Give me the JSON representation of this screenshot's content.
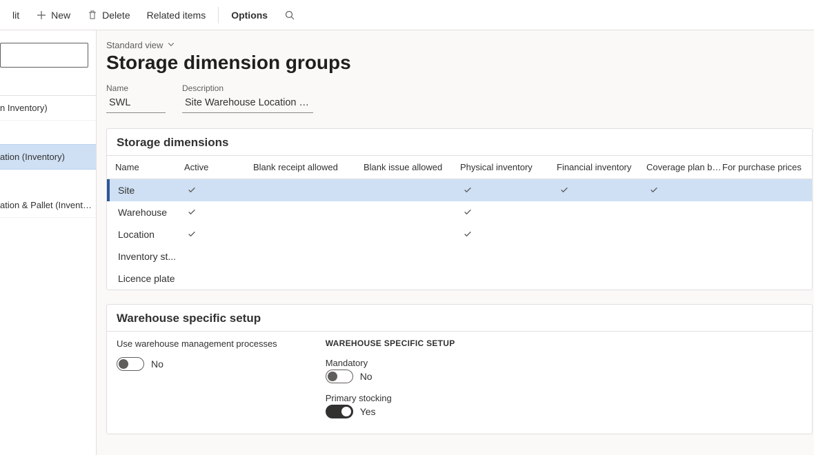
{
  "commandbar": {
    "edit": "lit",
    "new": "New",
    "delete": "Delete",
    "related": "Related items",
    "options": "Options"
  },
  "sidebar": {
    "items": [
      "n Inventory)",
      "ation (Inventory)",
      "ation & Pallet (Inventory)"
    ],
    "selected_index": 1
  },
  "view_switch": "Standard view",
  "page_title": "Storage dimension groups",
  "fields": {
    "name_label": "Name",
    "name_value": "SWL",
    "desc_label": "Description",
    "desc_value": "Site Warehouse Location (Inven..."
  },
  "grid": {
    "title": "Storage dimensions",
    "columns": [
      "Name",
      "Active",
      "Blank receipt allowed",
      "Blank issue allowed",
      "Physical inventory",
      "Financial inventory",
      "Coverage plan by di...",
      "For purchase prices"
    ],
    "rows": [
      {
        "name": "Site",
        "active": true,
        "blank_receipt": false,
        "blank_issue": false,
        "physical": true,
        "financial": true,
        "coverage": true,
        "purchase": false,
        "selected": true
      },
      {
        "name": "Warehouse",
        "active": true,
        "blank_receipt": false,
        "blank_issue": false,
        "physical": true,
        "financial": false,
        "coverage": false,
        "purchase": false
      },
      {
        "name": "Location",
        "active": true,
        "blank_receipt": false,
        "blank_issue": false,
        "physical": true,
        "financial": false,
        "coverage": false,
        "purchase": false
      },
      {
        "name": "Inventory st...",
        "active": false,
        "blank_receipt": false,
        "blank_issue": false,
        "physical": false,
        "financial": false,
        "coverage": false,
        "purchase": false
      },
      {
        "name": "Licence plate",
        "active": false,
        "blank_receipt": false,
        "blank_issue": false,
        "physical": false,
        "financial": false,
        "coverage": false,
        "purchase": false
      }
    ]
  },
  "wh": {
    "title": "Warehouse specific setup",
    "left_label": "Use warehouse management processes",
    "left_toggle": {
      "on": false,
      "text": "No"
    },
    "heading": "WAREHOUSE SPECIFIC SETUP",
    "mandatory_label": "Mandatory",
    "mandatory_toggle": {
      "on": false,
      "text": "No"
    },
    "primary_label": "Primary stocking",
    "primary_toggle": {
      "on": true,
      "text": "Yes"
    }
  }
}
